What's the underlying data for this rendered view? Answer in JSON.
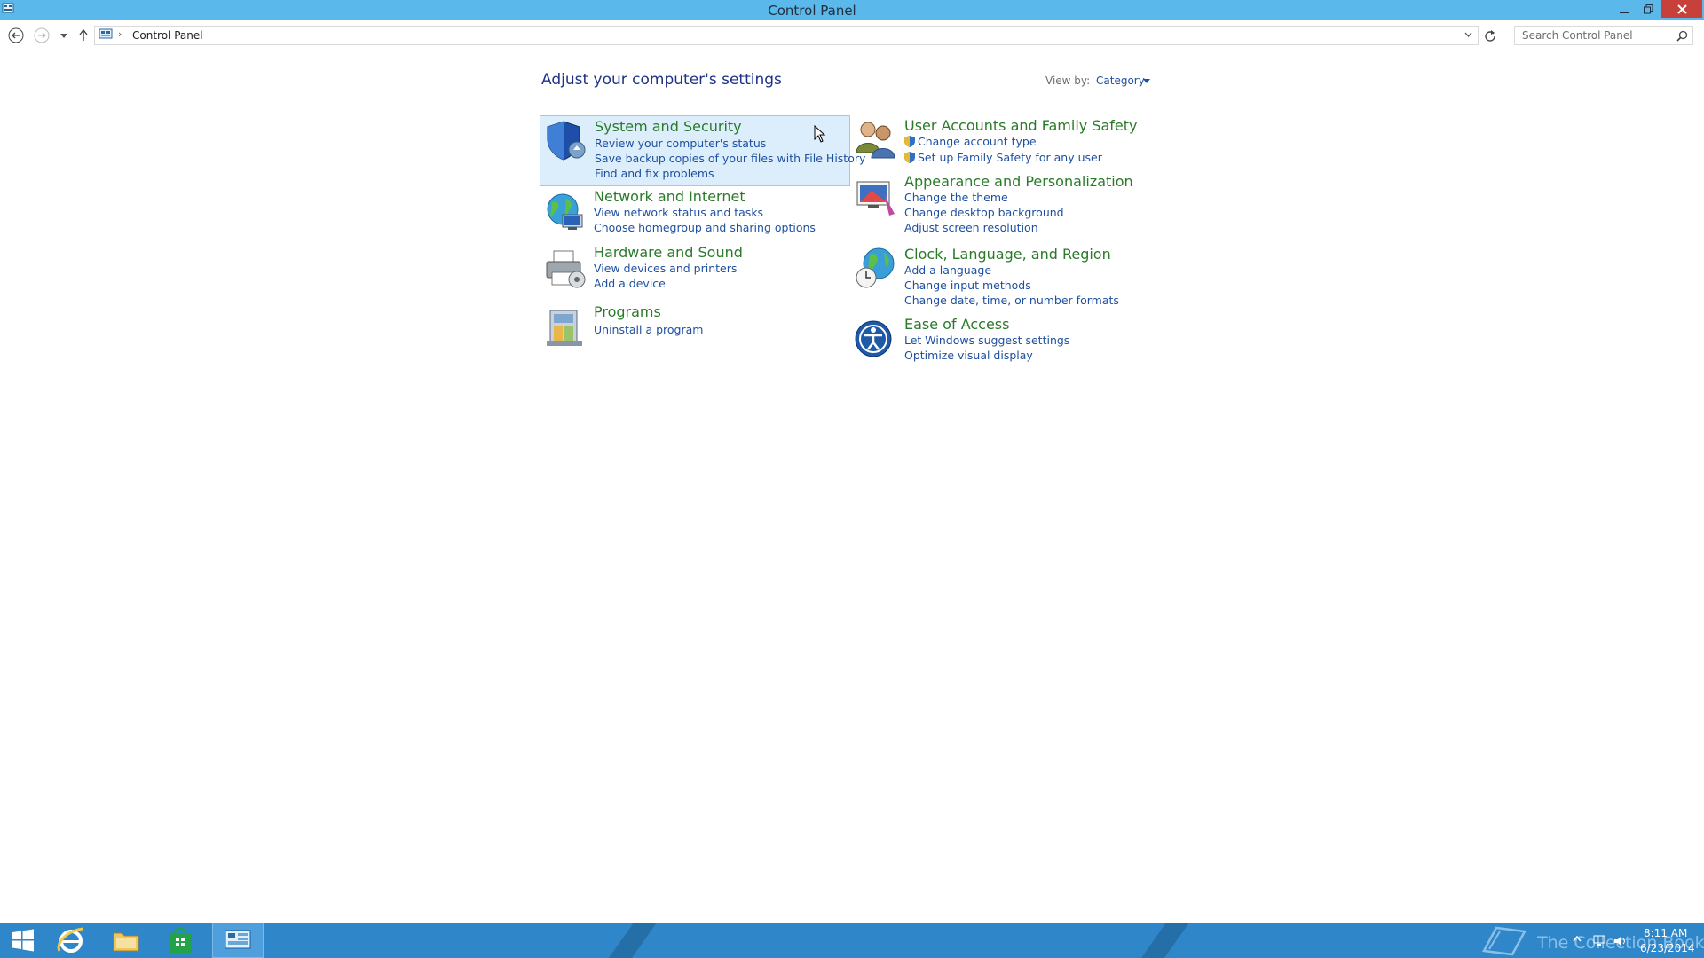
{
  "window": {
    "title": "Control Panel"
  },
  "address": {
    "breadcrumb": "Control Panel"
  },
  "search": {
    "placeholder": "Search Control Panel"
  },
  "content": {
    "heading": "Adjust your computer's settings",
    "view_by_label": "View by:",
    "view_by_value": "Category"
  },
  "categories": [
    {
      "icon": "security-shield-icon",
      "title": "System and Security",
      "links": [
        "Review your computer's status",
        "Save backup copies of your files with File History",
        "Find and fix problems"
      ]
    },
    {
      "icon": "network-globe-icon",
      "title": "Network and Internet",
      "links": [
        "View network status and tasks",
        "Choose homegroup and sharing options"
      ]
    },
    {
      "icon": "printer-icon",
      "title": "Hardware and Sound",
      "links": [
        "View devices and printers",
        "Add a device"
      ]
    },
    {
      "icon": "programs-icon",
      "title": "Programs",
      "links": [
        "Uninstall a program"
      ]
    },
    {
      "icon": "users-icon",
      "title": "User Accounts and Family Safety",
      "links": [
        "Change account type",
        "Set up Family Safety for any user"
      ]
    },
    {
      "icon": "appearance-icon",
      "title": "Appearance and Personalization",
      "links": [
        "Change the theme",
        "Change desktop background",
        "Adjust screen resolution"
      ]
    },
    {
      "icon": "clock-globe-icon",
      "title": "Clock, Language, and Region",
      "links": [
        "Add a language",
        "Change input methods",
        "Change date, time, or number formats"
      ]
    },
    {
      "icon": "ease-of-access-icon",
      "title": "Ease of Access",
      "links": [
        "Let Windows suggest settings",
        "Optimize visual display"
      ]
    }
  ],
  "taskbar": {
    "watermark": "The Collection Book",
    "time": "8:11 AM",
    "date": "6/23/2014",
    "apps": [
      "start-icon",
      "internet-explorer-icon",
      "file-explorer-icon",
      "store-icon",
      "control-panel-icon"
    ]
  },
  "colors": {
    "titlebar": "#5bb8ea",
    "taskbar": "#2f86c9",
    "category_title": "#2a7a2a",
    "link": "#1e50a0",
    "highlight": "#dceefb"
  }
}
